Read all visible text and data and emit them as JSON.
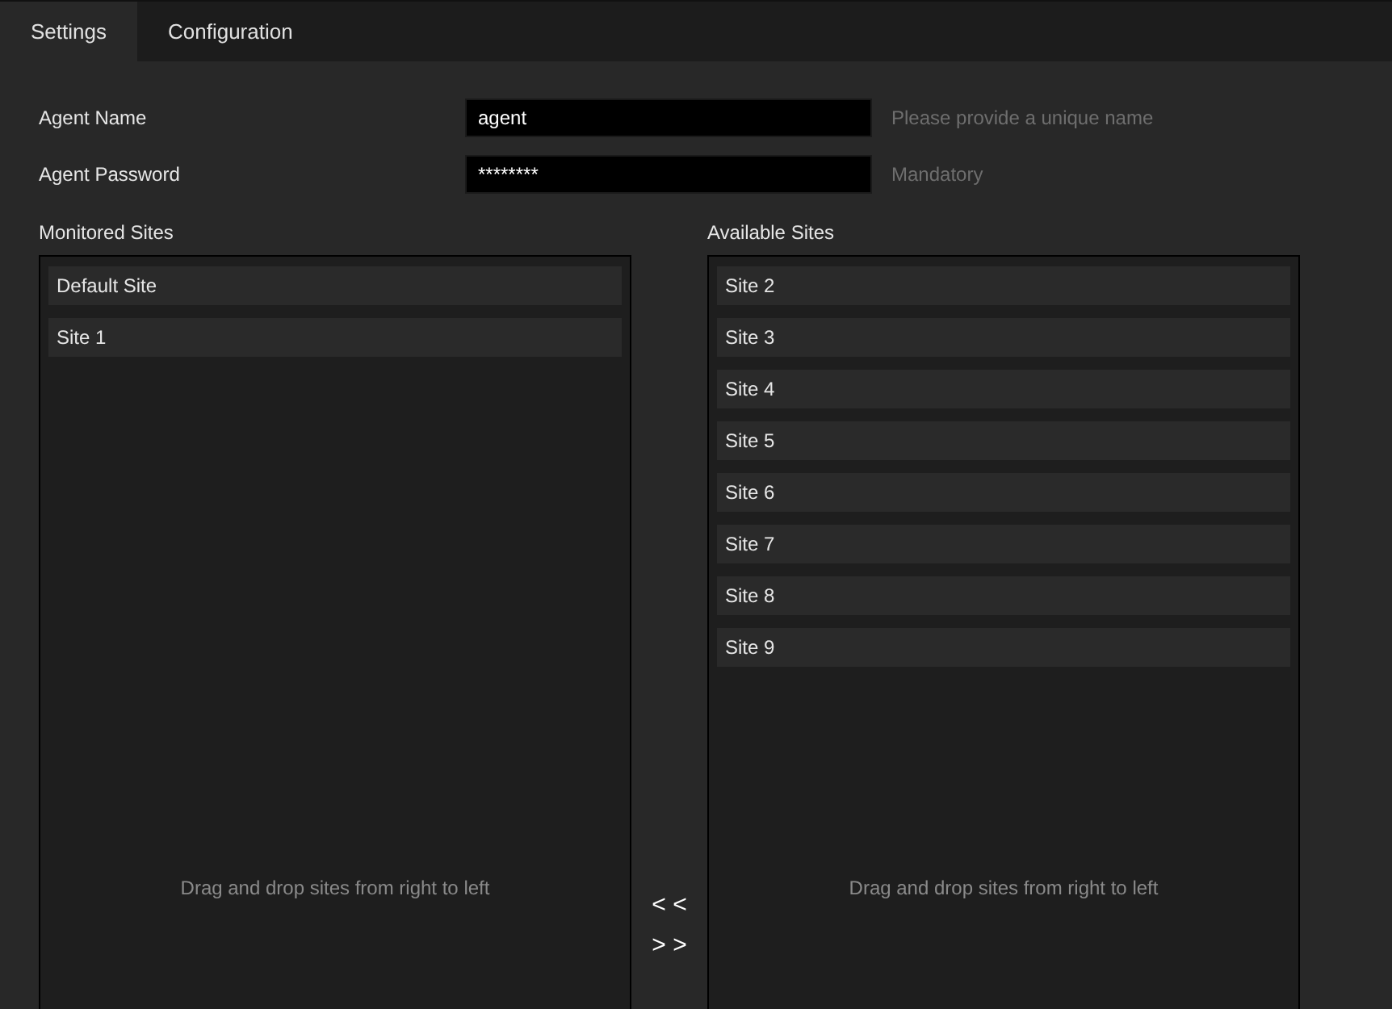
{
  "tabs": [
    {
      "label": "Settings",
      "selected": true
    },
    {
      "label": "Configuration",
      "selected": false
    }
  ],
  "fields": [
    {
      "label": "Agent Name",
      "value": "agent",
      "hint": "Please provide a unique name"
    },
    {
      "label": "Agent Password",
      "value": "********",
      "hint": "Mandatory"
    }
  ],
  "monitored_sites": {
    "title": "Monitored Sites",
    "items": [
      "Default Site",
      "Site 1"
    ],
    "drop_hint": "Drag and drop sites from right to left"
  },
  "move_buttons": [
    "< <",
    "> >"
  ],
  "available_sites": {
    "title": "Available Sites",
    "items": [
      "Site 2",
      "Site 3",
      "Site 4",
      "Site 5",
      "Site 6",
      "Site 7",
      "Site 8",
      "Site 9"
    ],
    "drop_hint": "Drag and drop sites from right to left"
  }
}
